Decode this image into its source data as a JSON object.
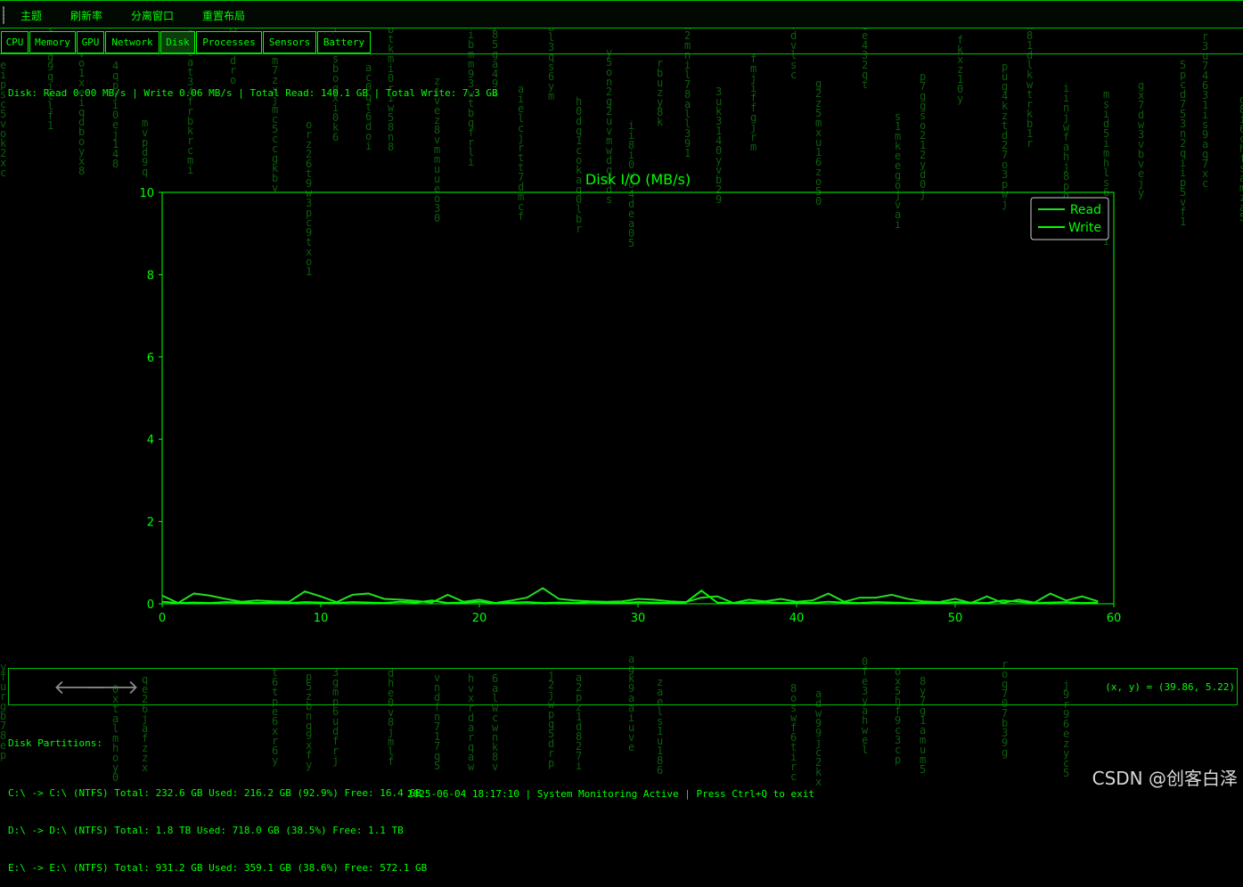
{
  "menu": {
    "items": [
      "主题",
      "刷新率",
      "分离窗口",
      "重置布局"
    ]
  },
  "tabs": [
    {
      "label": "CPU",
      "active": false
    },
    {
      "label": "Memory",
      "active": false
    },
    {
      "label": "GPU",
      "active": false
    },
    {
      "label": "Network",
      "active": false
    },
    {
      "label": "Disk",
      "active": true
    },
    {
      "label": "Processes",
      "active": false
    },
    {
      "label": "Sensors",
      "active": false
    },
    {
      "label": "Battery",
      "active": false
    }
  ],
  "summary": "Disk: Read 0.00 MB/s | Write 0.06 MB/s | Total Read: 140.1 GB | Total Write: 7.3 GB",
  "chart_data": {
    "type": "line",
    "title": "Disk I/O (MB/s)",
    "xlabel": "",
    "ylabel": "",
    "xlim": [
      0,
      60
    ],
    "ylim": [
      0,
      10
    ],
    "xticks": [
      0,
      10,
      20,
      30,
      40,
      50,
      60
    ],
    "yticks": [
      0,
      2,
      4,
      6,
      8,
      10
    ],
    "legend": "top-right",
    "grid": false,
    "x": [
      0,
      1,
      2,
      3,
      4,
      5,
      6,
      7,
      8,
      9,
      10,
      11,
      12,
      13,
      14,
      15,
      16,
      17,
      18,
      19,
      20,
      21,
      22,
      23,
      24,
      25,
      26,
      27,
      28,
      29,
      30,
      31,
      32,
      33,
      34,
      35,
      36,
      37,
      38,
      39,
      40,
      41,
      42,
      43,
      44,
      45,
      46,
      47,
      48,
      49,
      50,
      51,
      52,
      53,
      54,
      55,
      56,
      57,
      58,
      59
    ],
    "series": [
      {
        "name": "Read",
        "color": "#22dd22",
        "values": [
          0.2,
          0.02,
          0.25,
          0.2,
          0.12,
          0.05,
          0.08,
          0.06,
          0.05,
          0.3,
          0.18,
          0.04,
          0.22,
          0.25,
          0.12,
          0.1,
          0.07,
          0.03,
          0.22,
          0.05,
          0.1,
          0.02,
          0.08,
          0.15,
          0.38,
          0.12,
          0.08,
          0.06,
          0.05,
          0.06,
          0.12,
          0.1,
          0.06,
          0.04,
          0.15,
          0.18,
          0.02,
          0.1,
          0.06,
          0.12,
          0.05,
          0.08,
          0.25,
          0.05,
          0.15,
          0.15,
          0.22,
          0.12,
          0.06,
          0.04,
          0.12,
          0.02,
          0.18,
          0.02,
          0.1,
          0.03,
          0.25,
          0.08,
          0.18,
          0.06
        ]
      },
      {
        "name": "Write",
        "color": "#00ff00",
        "values": [
          0.05,
          0.02,
          0.03,
          0.02,
          0.04,
          0.03,
          0.02,
          0.03,
          0.02,
          0.04,
          0.03,
          0.02,
          0.04,
          0.03,
          0.02,
          0.05,
          0.03,
          0.08,
          0.02,
          0.03,
          0.05,
          0.02,
          0.03,
          0.04,
          0.02,
          0.03,
          0.02,
          0.04,
          0.03,
          0.02,
          0.04,
          0.03,
          0.02,
          0.03,
          0.32,
          0.03,
          0.02,
          0.03,
          0.04,
          0.02,
          0.03,
          0.02,
          0.05,
          0.03,
          0.02,
          0.04,
          0.03,
          0.02,
          0.03,
          0.02,
          0.04,
          0.03,
          0.02,
          0.08,
          0.05,
          0.02,
          0.03,
          0.04,
          0.02,
          0.03
        ]
      }
    ]
  },
  "nav": {
    "back_icon": "arrow-left-icon",
    "forward_icon": "arrow-right-icon",
    "coords": "(x, y) = (39.86, 5.22)"
  },
  "partitions": {
    "title": "Disk Partitions:",
    "lines": [
      "C:\\ -> C:\\ (NTFS) Total: 232.6 GB Used: 216.2 GB (92.9%) Free: 16.4 GB",
      "D:\\ -> D:\\ (NTFS) Total: 1.8 TB Used: 718.0 GB (38.5%) Free: 1.1 TB",
      "E:\\ -> E:\\ (NTFS) Total: 931.2 GB Used: 359.1 GB (38.6%) Free: 572.1 GB"
    ]
  },
  "status": "2025-06-04 18:17:10 | System Monitoring Active | Press Ctrl+Q to exit",
  "watermark": "CSDN @创客白泽",
  "colors": {
    "accent": "#00ff00",
    "background": "#000000",
    "active_tab": "#0c3b0c"
  }
}
